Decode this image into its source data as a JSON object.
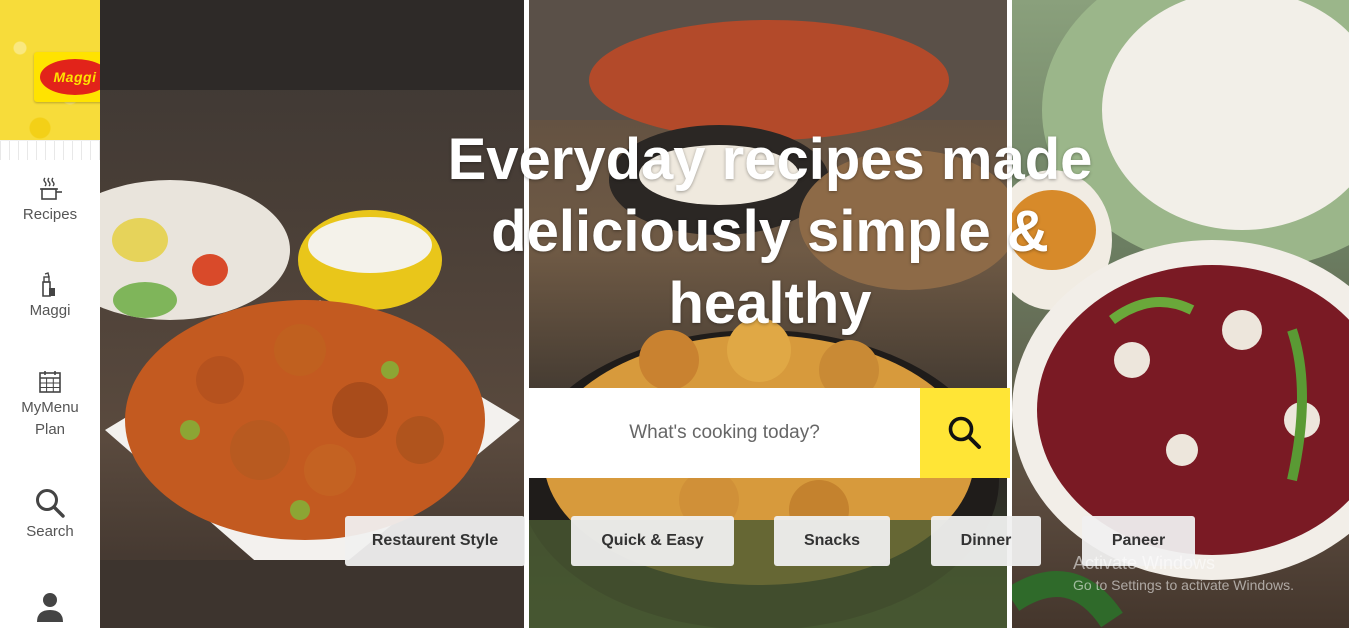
{
  "brand": {
    "logo_text": "Maggi",
    "colors": {
      "yellow": "#ffe300",
      "red": "#e2231a"
    }
  },
  "sidebar": {
    "items": [
      {
        "label": "Recipes",
        "icon": "cooking-pot-icon"
      },
      {
        "label": "Maggi",
        "icon": "bottle-icon"
      },
      {
        "label_line1": "MyMenu",
        "label_line2": "Plan",
        "icon": "calendar-icon"
      },
      {
        "label": "Search",
        "icon": "search-icon"
      },
      {
        "label": "",
        "icon": "user-icon"
      }
    ]
  },
  "hero": {
    "title_line1": "Everyday recipes made",
    "title_line2": "deliciously simple &",
    "title_line3": "healthy",
    "search": {
      "placeholder": "What's cooking today?",
      "button_icon": "search-icon"
    },
    "chips": [
      "Restaurent Style",
      "Quick & Easy",
      "Snacks",
      "Dinner",
      "Paneer"
    ]
  },
  "watermark": {
    "line1": "Activate Windows",
    "line2": "Go to Settings to activate Windows."
  }
}
